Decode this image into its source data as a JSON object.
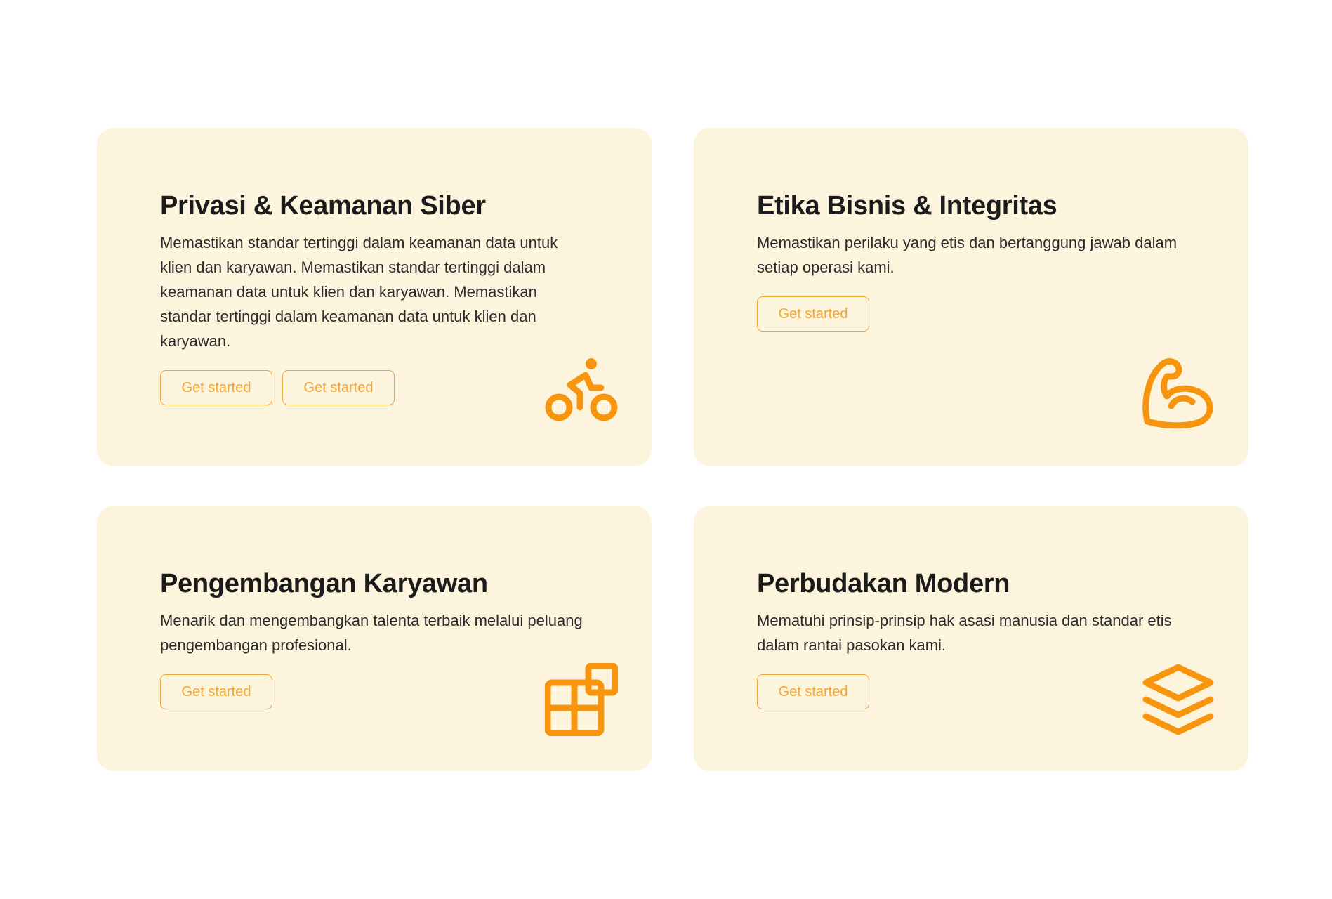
{
  "colors": {
    "card_background": "#fdf4de",
    "accent": "#f7950f",
    "button_border": "#f2a733",
    "title": "#1b1b1b"
  },
  "cards": [
    {
      "title": "Privasi & Keamanan Siber",
      "description": "Memastikan standar tertinggi dalam keamanan data untuk klien dan karyawan. Memastikan standar tertinggi dalam keamanan data untuk klien dan karyawan. Memastikan standar tertinggi dalam keamanan data untuk klien dan karyawan.",
      "buttons": [
        "Get started",
        "Get started"
      ],
      "icon": "bicycle-rider-icon"
    },
    {
      "title": "Etika Bisnis & Integritas",
      "description": "Memastikan perilaku yang etis dan bertanggung jawab dalam setiap operasi kami.",
      "buttons": [
        "Get started"
      ],
      "icon": "flexed-arm-icon"
    },
    {
      "title": "Pengembangan Karyawan",
      "description": "Menarik dan mengembangkan talenta terbaik melalui peluang pengembangan profesional.",
      "buttons": [
        "Get started"
      ],
      "icon": "blocks-grid-icon"
    },
    {
      "title": "Perbudakan Modern",
      "description": "Mematuhi prinsip-prinsip hak asasi manusia dan standar etis dalam rantai pasokan kami.",
      "buttons": [
        "Get started"
      ],
      "icon": "layers-stack-icon"
    }
  ]
}
